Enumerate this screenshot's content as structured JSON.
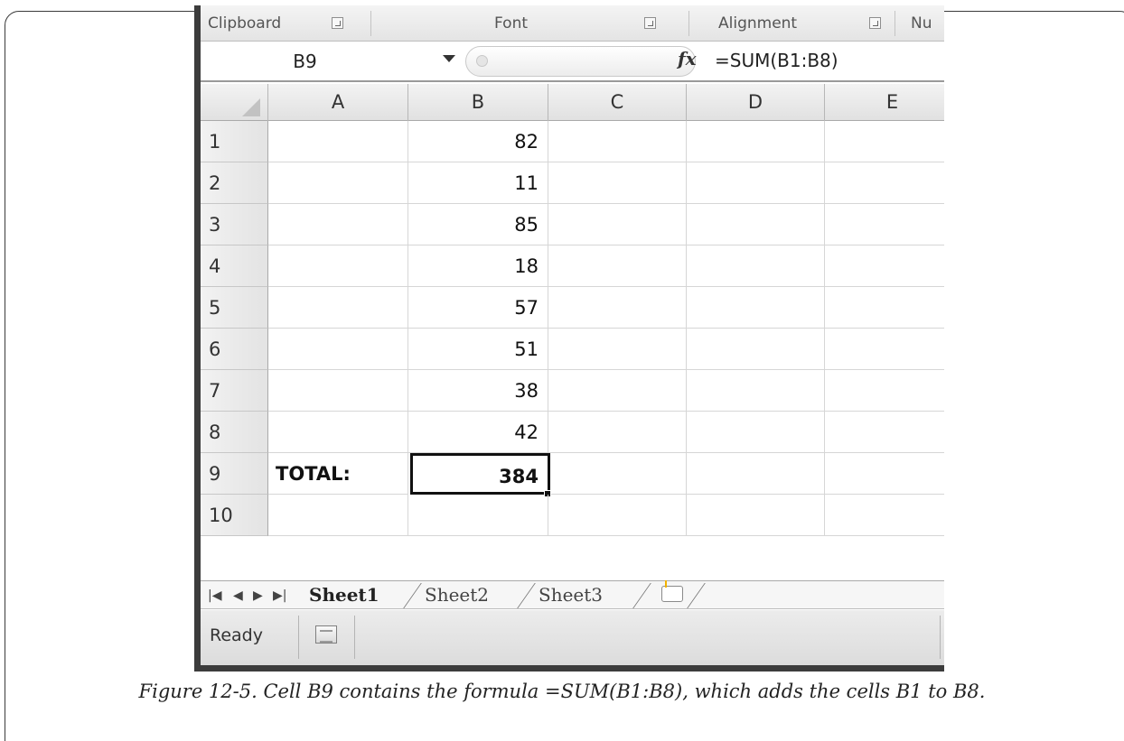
{
  "ribbon": {
    "groups": [
      "Clipboard",
      "Font",
      "Alignment",
      "Nu"
    ]
  },
  "formula_bar": {
    "name_box": "B9",
    "fx_label": "fx",
    "formula": "=SUM(B1:B8)"
  },
  "columns": [
    "A",
    "B",
    "C",
    "D",
    "E"
  ],
  "rows": [
    {
      "num": "1",
      "A": "",
      "B": "82"
    },
    {
      "num": "2",
      "A": "",
      "B": "11"
    },
    {
      "num": "3",
      "A": "",
      "B": "85"
    },
    {
      "num": "4",
      "A": "",
      "B": "18"
    },
    {
      "num": "5",
      "A": "",
      "B": "57"
    },
    {
      "num": "6",
      "A": "",
      "B": "51"
    },
    {
      "num": "7",
      "A": "",
      "B": "38"
    },
    {
      "num": "8",
      "A": "",
      "B": "42"
    },
    {
      "num": "9",
      "A": "TOTAL:",
      "B": "384"
    },
    {
      "num": "10",
      "A": "",
      "B": ""
    }
  ],
  "selected_cell": "B9",
  "sheet_tabs": [
    "Sheet1",
    "Sheet2",
    "Sheet3"
  ],
  "active_sheet": "Sheet1",
  "status": {
    "text": "Ready"
  },
  "caption": "Figure 12-5. Cell B9 contains the formula =SUM(B1:B8), which adds the cells B1 to B8."
}
